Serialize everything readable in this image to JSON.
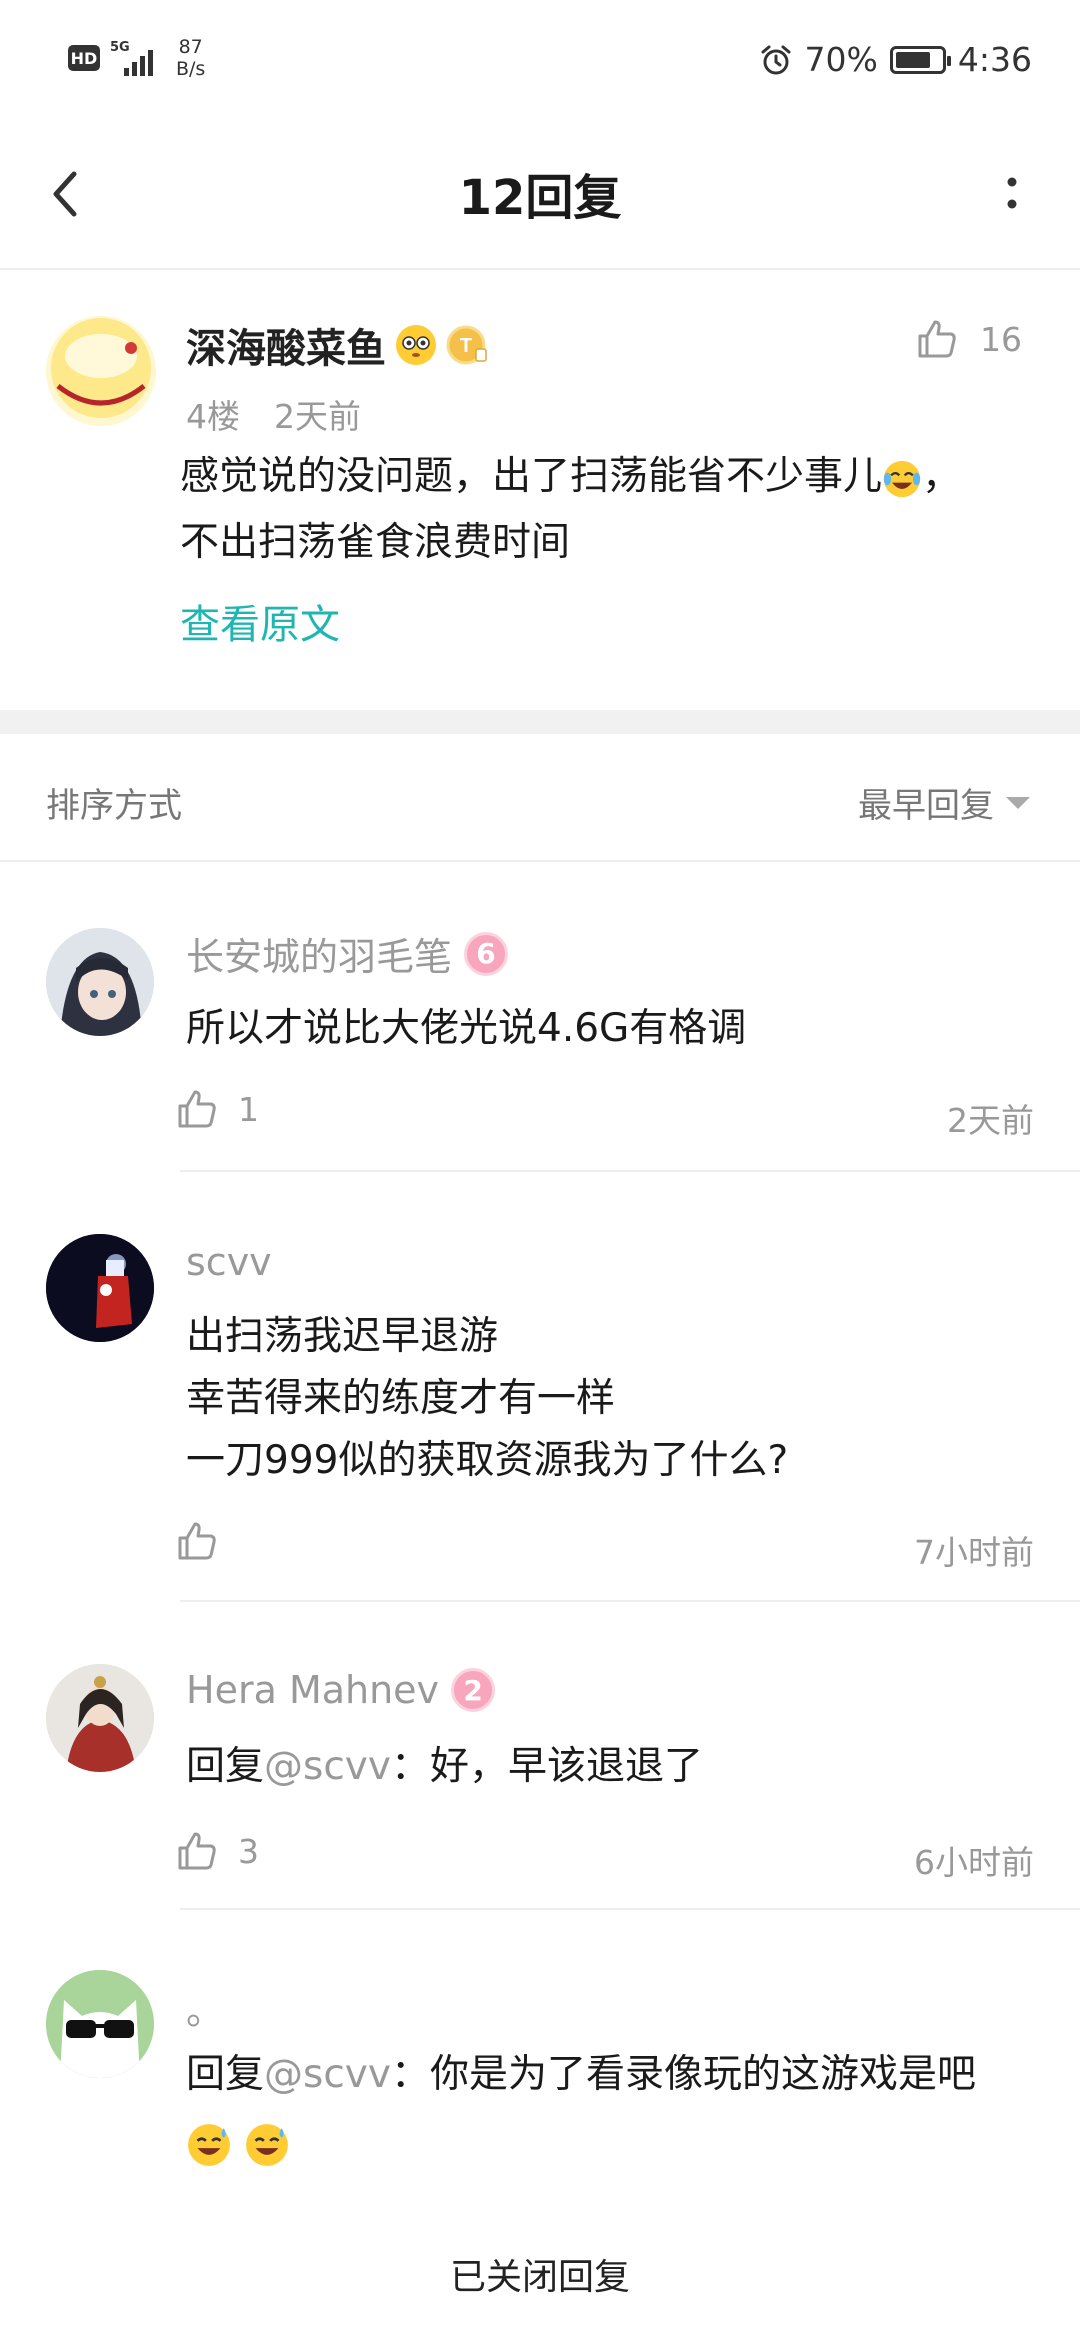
{
  "status_bar": {
    "hd": "HD",
    "network": "5G",
    "speed_value": "87",
    "speed_unit": "B/s",
    "battery": "70%",
    "time": "4:36"
  },
  "header": {
    "title": "12回复"
  },
  "main_post": {
    "username": "深海酸菜鱼",
    "likes": "16",
    "floor": "4楼",
    "time": "2天前",
    "text_line1": "感觉说的没问题，出了扫荡能省不少事儿",
    "text_line1_end": "，",
    "text_line2": "不出扫荡雀食浪费时间",
    "view_original": "查看原文"
  },
  "sort": {
    "label": "排序方式",
    "selected": "最早回复"
  },
  "replies": [
    {
      "username": "长安城的羽毛笔",
      "badge": "6",
      "text": "所以才说比大佬光说4.6G有格调",
      "likes": "1",
      "time": "2天前"
    },
    {
      "username": "scvv",
      "text_lines": [
        "出扫荡我迟早退游",
        "幸苦得来的练度才有一样",
        "一刀999似的获取资源我为了什么?"
      ],
      "likes": "",
      "time": "7小时前"
    },
    {
      "username": "Hera Mahnev",
      "badge": "2",
      "reply_prefix": "回复",
      "mention": "@scvv",
      "text": "：好，早该退退了",
      "likes": "3",
      "time": "6小时前"
    },
    {
      "username": "。",
      "reply_prefix": "回复",
      "mention": "@scvv",
      "text": "：你是为了看录像玩的这游戏是吧"
    }
  ],
  "footer": {
    "text": "已关闭回复"
  },
  "colors": {
    "accent": "#1fb6b1",
    "muted_text": "#999999",
    "badge_pink": "#f7a6bd"
  },
  "icons": [
    "back-arrow-icon",
    "more-vertical-icon",
    "thumbs-up-icon",
    "alarm-icon",
    "battery-icon"
  ]
}
